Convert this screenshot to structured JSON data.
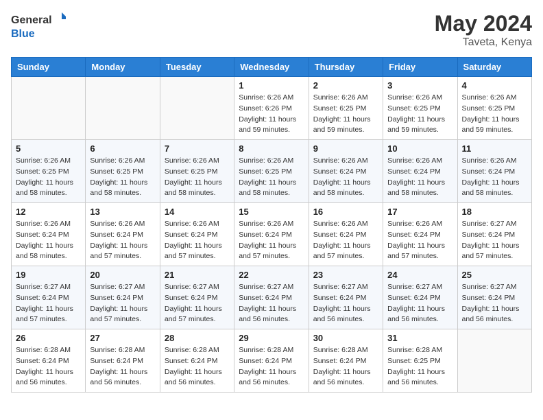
{
  "header": {
    "logo_line1": "General",
    "logo_line2": "Blue",
    "month_title": "May 2024",
    "location": "Taveta, Kenya"
  },
  "weekdays": [
    "Sunday",
    "Monday",
    "Tuesday",
    "Wednesday",
    "Thursday",
    "Friday",
    "Saturday"
  ],
  "weeks": [
    [
      {
        "day": "",
        "sunrise": "",
        "sunset": "",
        "daylight": ""
      },
      {
        "day": "",
        "sunrise": "",
        "sunset": "",
        "daylight": ""
      },
      {
        "day": "",
        "sunrise": "",
        "sunset": "",
        "daylight": ""
      },
      {
        "day": "1",
        "sunrise": "Sunrise: 6:26 AM",
        "sunset": "Sunset: 6:26 PM",
        "daylight": "Daylight: 11 hours and 59 minutes."
      },
      {
        "day": "2",
        "sunrise": "Sunrise: 6:26 AM",
        "sunset": "Sunset: 6:25 PM",
        "daylight": "Daylight: 11 hours and 59 minutes."
      },
      {
        "day": "3",
        "sunrise": "Sunrise: 6:26 AM",
        "sunset": "Sunset: 6:25 PM",
        "daylight": "Daylight: 11 hours and 59 minutes."
      },
      {
        "day": "4",
        "sunrise": "Sunrise: 6:26 AM",
        "sunset": "Sunset: 6:25 PM",
        "daylight": "Daylight: 11 hours and 59 minutes."
      }
    ],
    [
      {
        "day": "5",
        "sunrise": "Sunrise: 6:26 AM",
        "sunset": "Sunset: 6:25 PM",
        "daylight": "Daylight: 11 hours and 58 minutes."
      },
      {
        "day": "6",
        "sunrise": "Sunrise: 6:26 AM",
        "sunset": "Sunset: 6:25 PM",
        "daylight": "Daylight: 11 hours and 58 minutes."
      },
      {
        "day": "7",
        "sunrise": "Sunrise: 6:26 AM",
        "sunset": "Sunset: 6:25 PM",
        "daylight": "Daylight: 11 hours and 58 minutes."
      },
      {
        "day": "8",
        "sunrise": "Sunrise: 6:26 AM",
        "sunset": "Sunset: 6:25 PM",
        "daylight": "Daylight: 11 hours and 58 minutes."
      },
      {
        "day": "9",
        "sunrise": "Sunrise: 6:26 AM",
        "sunset": "Sunset: 6:24 PM",
        "daylight": "Daylight: 11 hours and 58 minutes."
      },
      {
        "day": "10",
        "sunrise": "Sunrise: 6:26 AM",
        "sunset": "Sunset: 6:24 PM",
        "daylight": "Daylight: 11 hours and 58 minutes."
      },
      {
        "day": "11",
        "sunrise": "Sunrise: 6:26 AM",
        "sunset": "Sunset: 6:24 PM",
        "daylight": "Daylight: 11 hours and 58 minutes."
      }
    ],
    [
      {
        "day": "12",
        "sunrise": "Sunrise: 6:26 AM",
        "sunset": "Sunset: 6:24 PM",
        "daylight": "Daylight: 11 hours and 58 minutes."
      },
      {
        "day": "13",
        "sunrise": "Sunrise: 6:26 AM",
        "sunset": "Sunset: 6:24 PM",
        "daylight": "Daylight: 11 hours and 57 minutes."
      },
      {
        "day": "14",
        "sunrise": "Sunrise: 6:26 AM",
        "sunset": "Sunset: 6:24 PM",
        "daylight": "Daylight: 11 hours and 57 minutes."
      },
      {
        "day": "15",
        "sunrise": "Sunrise: 6:26 AM",
        "sunset": "Sunset: 6:24 PM",
        "daylight": "Daylight: 11 hours and 57 minutes."
      },
      {
        "day": "16",
        "sunrise": "Sunrise: 6:26 AM",
        "sunset": "Sunset: 6:24 PM",
        "daylight": "Daylight: 11 hours and 57 minutes."
      },
      {
        "day": "17",
        "sunrise": "Sunrise: 6:26 AM",
        "sunset": "Sunset: 6:24 PM",
        "daylight": "Daylight: 11 hours and 57 minutes."
      },
      {
        "day": "18",
        "sunrise": "Sunrise: 6:27 AM",
        "sunset": "Sunset: 6:24 PM",
        "daylight": "Daylight: 11 hours and 57 minutes."
      }
    ],
    [
      {
        "day": "19",
        "sunrise": "Sunrise: 6:27 AM",
        "sunset": "Sunset: 6:24 PM",
        "daylight": "Daylight: 11 hours and 57 minutes."
      },
      {
        "day": "20",
        "sunrise": "Sunrise: 6:27 AM",
        "sunset": "Sunset: 6:24 PM",
        "daylight": "Daylight: 11 hours and 57 minutes."
      },
      {
        "day": "21",
        "sunrise": "Sunrise: 6:27 AM",
        "sunset": "Sunset: 6:24 PM",
        "daylight": "Daylight: 11 hours and 57 minutes."
      },
      {
        "day": "22",
        "sunrise": "Sunrise: 6:27 AM",
        "sunset": "Sunset: 6:24 PM",
        "daylight": "Daylight: 11 hours and 56 minutes."
      },
      {
        "day": "23",
        "sunrise": "Sunrise: 6:27 AM",
        "sunset": "Sunset: 6:24 PM",
        "daylight": "Daylight: 11 hours and 56 minutes."
      },
      {
        "day": "24",
        "sunrise": "Sunrise: 6:27 AM",
        "sunset": "Sunset: 6:24 PM",
        "daylight": "Daylight: 11 hours and 56 minutes."
      },
      {
        "day": "25",
        "sunrise": "Sunrise: 6:27 AM",
        "sunset": "Sunset: 6:24 PM",
        "daylight": "Daylight: 11 hours and 56 minutes."
      }
    ],
    [
      {
        "day": "26",
        "sunrise": "Sunrise: 6:28 AM",
        "sunset": "Sunset: 6:24 PM",
        "daylight": "Daylight: 11 hours and 56 minutes."
      },
      {
        "day": "27",
        "sunrise": "Sunrise: 6:28 AM",
        "sunset": "Sunset: 6:24 PM",
        "daylight": "Daylight: 11 hours and 56 minutes."
      },
      {
        "day": "28",
        "sunrise": "Sunrise: 6:28 AM",
        "sunset": "Sunset: 6:24 PM",
        "daylight": "Daylight: 11 hours and 56 minutes."
      },
      {
        "day": "29",
        "sunrise": "Sunrise: 6:28 AM",
        "sunset": "Sunset: 6:24 PM",
        "daylight": "Daylight: 11 hours and 56 minutes."
      },
      {
        "day": "30",
        "sunrise": "Sunrise: 6:28 AM",
        "sunset": "Sunset: 6:24 PM",
        "daylight": "Daylight: 11 hours and 56 minutes."
      },
      {
        "day": "31",
        "sunrise": "Sunrise: 6:28 AM",
        "sunset": "Sunset: 6:25 PM",
        "daylight": "Daylight: 11 hours and 56 minutes."
      },
      {
        "day": "",
        "sunrise": "",
        "sunset": "",
        "daylight": ""
      }
    ]
  ]
}
